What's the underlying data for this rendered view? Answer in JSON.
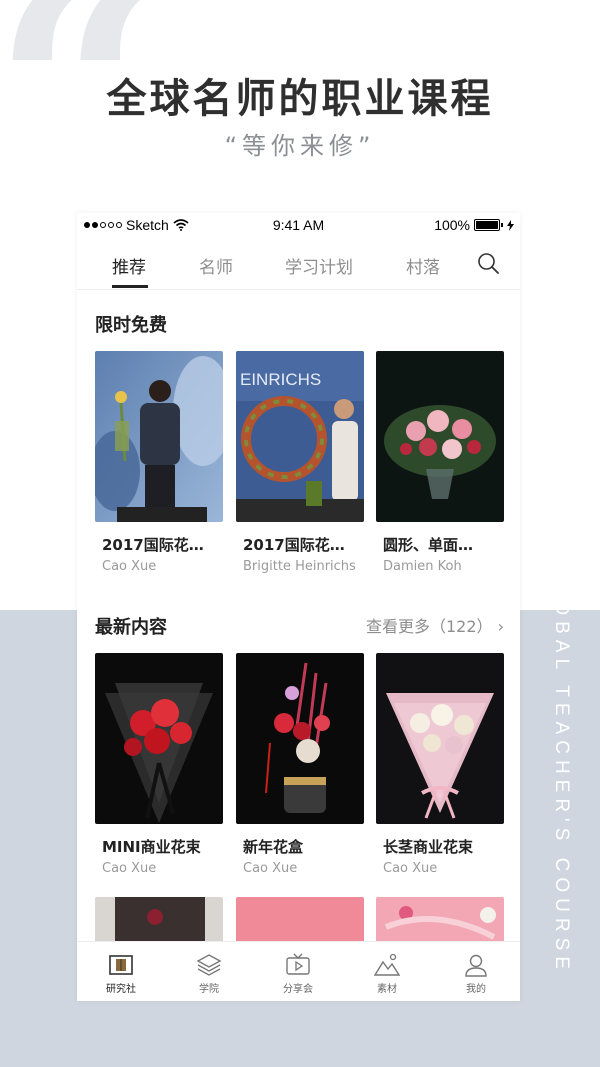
{
  "header": {
    "headline": "全球名师的职业课程",
    "subline": "“等你来修”",
    "vertical_text": "GLOBAL TEACHER'S COURSE"
  },
  "statusbar": {
    "carrier": "Sketch",
    "time": "9:41 AM",
    "battery": "100%"
  },
  "tabs": [
    {
      "label": "推荐",
      "active": true
    },
    {
      "label": "名师",
      "active": false
    },
    {
      "label": "学习计划",
      "active": false
    },
    {
      "label": "村落",
      "active": false
    }
  ],
  "free_section": {
    "title": "限时免费",
    "cards": [
      {
        "title": "2017国际花…",
        "author": "Cao Xue"
      },
      {
        "title": "2017国际花…",
        "author": "Brigitte Heinrichs",
        "image_text": "EINRICHS"
      },
      {
        "title": "圆形、单面…",
        "author": "Damien Koh"
      }
    ]
  },
  "latest_section": {
    "title": "最新内容",
    "see_more": "查看更多（122）",
    "cards": [
      {
        "title": "MINI商业花束",
        "author": "Cao Xue"
      },
      {
        "title": "新年花盒",
        "author": "Cao Xue"
      },
      {
        "title": "长茎商业花束",
        "author": "Cao Xue"
      }
    ]
  },
  "bottom_nav": [
    {
      "label": "研究社",
      "icon": "book-icon",
      "active": true
    },
    {
      "label": "学院",
      "icon": "layers-icon",
      "active": false
    },
    {
      "label": "分享会",
      "icon": "video-icon",
      "active": false
    },
    {
      "label": "素材",
      "icon": "mountain-icon",
      "active": false
    },
    {
      "label": "我的",
      "icon": "user-icon",
      "active": false
    }
  ],
  "colors": {
    "accent": "#222222",
    "muted": "#8e8e8e",
    "background_lower": "#cfd6df"
  }
}
